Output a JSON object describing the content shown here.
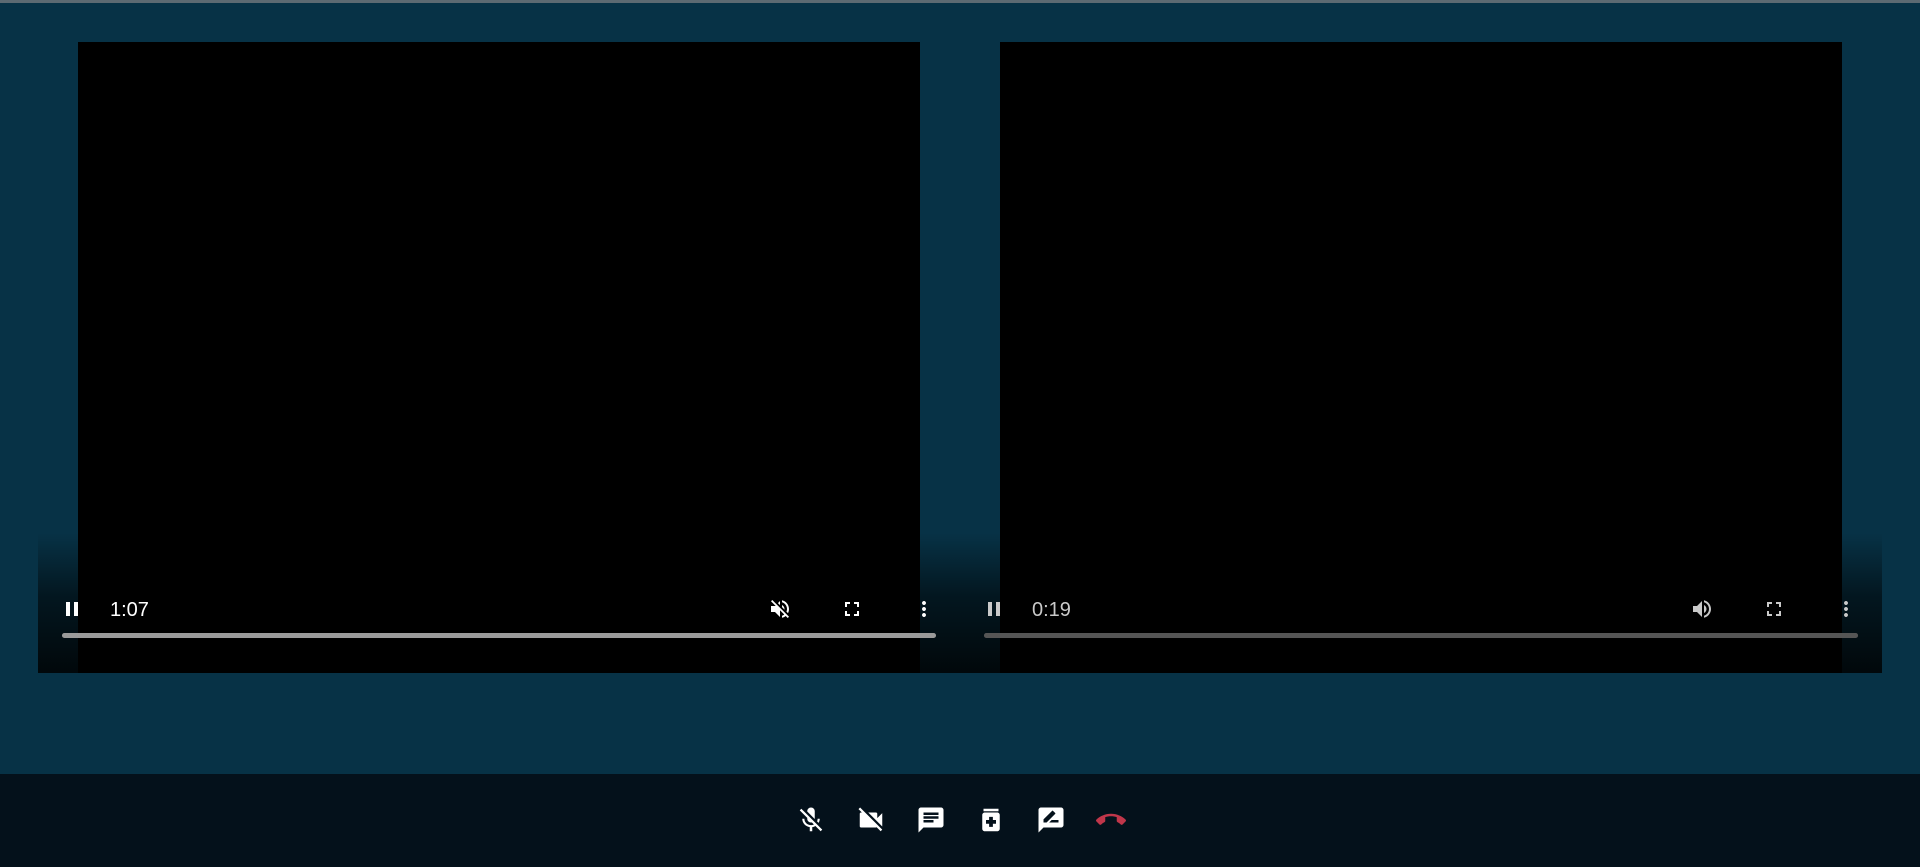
{
  "players": [
    {
      "time": "1:07",
      "progress": 1.0,
      "icons": [
        "pause-icon",
        "volume-off-icon",
        "fullscreen-icon",
        "more-vert-icon"
      ]
    },
    {
      "time": "0:19",
      "progress": 1.0,
      "icons": [
        "pause-icon",
        "volume-up-icon",
        "fullscreen-icon",
        "more-vert-icon"
      ]
    }
  ],
  "toolbar": {
    "buttons": [
      {
        "icon": "mic-off-icon"
      },
      {
        "icon": "videocam-off-icon"
      },
      {
        "icon": "chat-icon"
      },
      {
        "icon": "medical-bottle-icon"
      },
      {
        "icon": "rate-review-icon"
      },
      {
        "icon": "call-end-icon"
      }
    ]
  },
  "colors": {
    "stage_background": "#073246",
    "bottom_bar": "#04111b",
    "end_call": "#c0364a",
    "video": "#000000"
  }
}
